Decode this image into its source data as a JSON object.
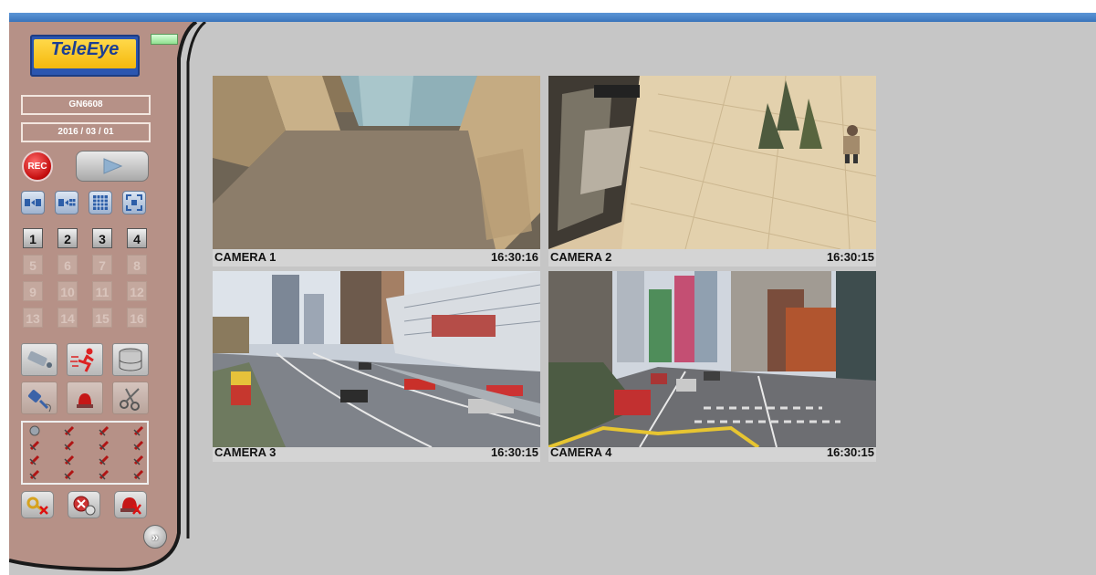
{
  "logo": {
    "text": "TeleEye"
  },
  "device": {
    "model": "GN6608",
    "date": "2016 / 03 / 01"
  },
  "controls": {
    "rec_label": "REC",
    "view_buttons": [
      "sequence-forward-icon",
      "sequence-quad-icon",
      "grid-view-icon",
      "fullscreen-icon"
    ],
    "channels": [
      "1",
      "2",
      "3",
      "4",
      "5",
      "6",
      "7",
      "8",
      "9",
      "10",
      "11",
      "12",
      "13",
      "14",
      "15",
      "16"
    ],
    "active_channels": 4,
    "tools": [
      "camera-icon",
      "motion-alarm-icon",
      "database-icon",
      "plug-icon",
      "siren-icon",
      "cut-icon"
    ],
    "more_label": "»"
  },
  "cameras": [
    {
      "label": "CAMERA 1",
      "time": "16:30:16"
    },
    {
      "label": "CAMERA 2",
      "time": "16:30:15"
    },
    {
      "label": "CAMERA 3",
      "time": "16:30:15"
    },
    {
      "label": "CAMERA 4",
      "time": "16:30:15"
    }
  ],
  "colors": {
    "title_bar": "#4a85c9",
    "panel": "#b69187",
    "workspace": "#c6c6c6",
    "rec": "#d11414"
  }
}
